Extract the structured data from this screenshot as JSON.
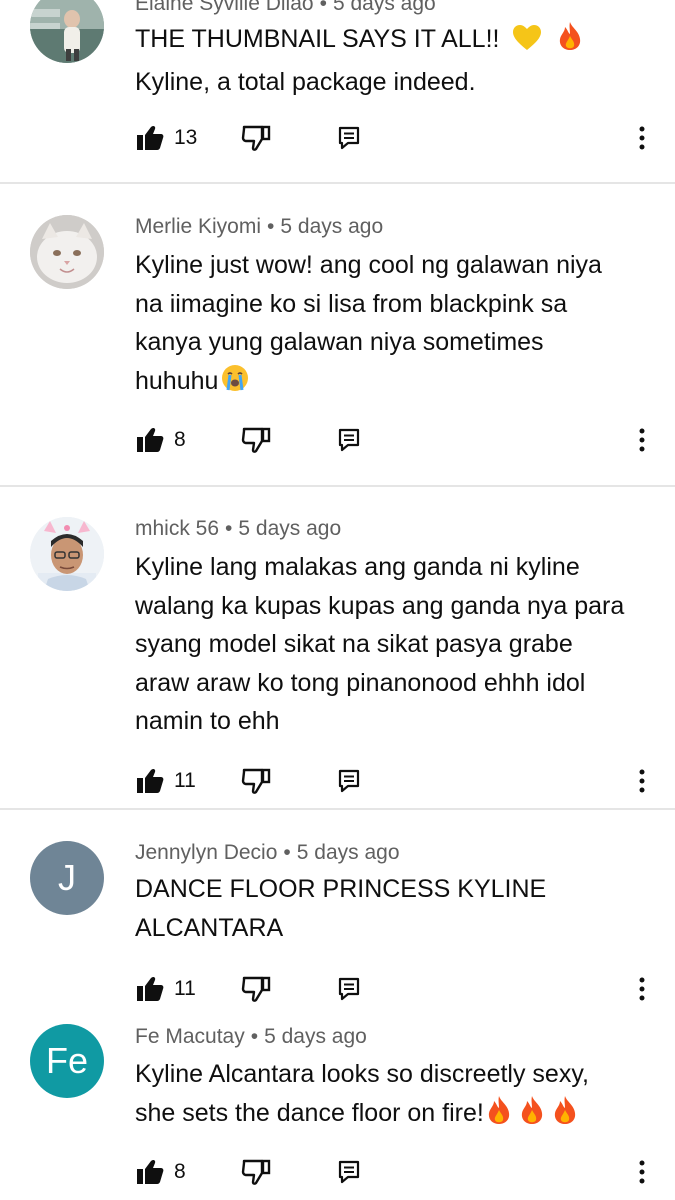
{
  "comments": [
    {
      "author": "Elaine Syville Dilao",
      "time": "5 days ago",
      "lines": [
        "THE THUMBNAIL SAYS IT ALL!!",
        "Kyline, a total package indeed."
      ],
      "emoji_line1": [
        "yellow-heart-emoji",
        "fire-emoji"
      ],
      "likes": "13"
    },
    {
      "author": "Merlie Kiyomi",
      "time": "5 days ago",
      "lines": [
        "Kyline just wow!  ang cool ng galawan niya",
        "na iimagine ko si lisa from blackpink sa",
        "kanya yung galawan niya sometimes",
        "huhuhu"
      ],
      "emoji_last": "loudly-crying-emoji",
      "likes": "8"
    },
    {
      "author": "mhick 56",
      "time": "5 days ago",
      "lines": [
        "Kyline lang malakas ang ganda ni kyline",
        "walang ka kupas kupas ang ganda nya para",
        "syang model sikat na sikat pasya grabe",
        "araw araw ko tong pinanonood ehhh idol",
        "namin to ehh"
      ],
      "likes": "11"
    },
    {
      "author": "Jennylyn Decio",
      "time": "5 days ago",
      "avatar_letter": "J",
      "avatar_color": "#6f8596",
      "lines": [
        "DANCE FLOOR PRINCESS KYLINE",
        "ALCANTARA"
      ],
      "likes": "11"
    },
    {
      "author": "Fe Macutay",
      "time": "5 days ago",
      "avatar_letter": "Fe",
      "avatar_color": "#109aa3",
      "lines": [
        "Kyline Alcantara looks so discreetly sexy,",
        "she sets the dance floor on fire!"
      ],
      "emoji_last": "fire-emoji-x3",
      "likes": "8"
    }
  ],
  "icons": {
    "like": "thumbs-up-icon",
    "dislike": "thumbs-down-icon",
    "reply": "reply-icon",
    "more": "more-vertical-icon"
  },
  "colors": {
    "meta_text": "#606060",
    "divider": "#e5e5e5"
  }
}
